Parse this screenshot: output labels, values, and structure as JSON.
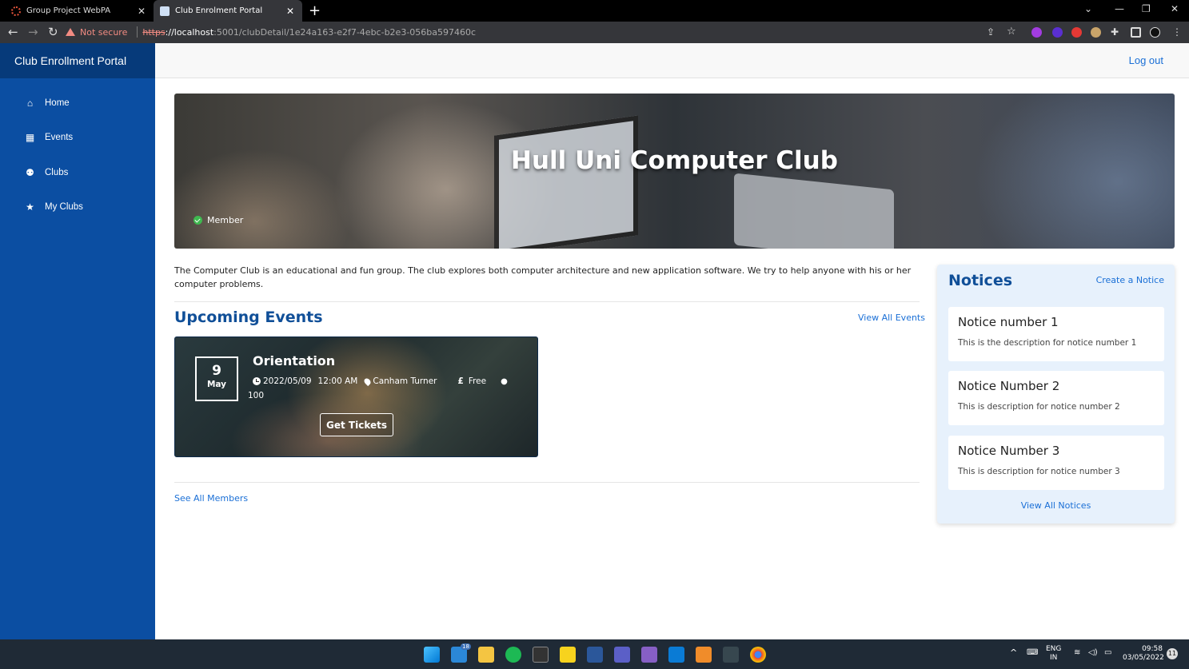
{
  "browser": {
    "tabs": [
      {
        "title": "Group Project WebPA",
        "active": false
      },
      {
        "title": "Club Enrolment Portal",
        "active": true
      }
    ],
    "security_label": "Not secure",
    "url_scheme": "https",
    "url_host": "://localhost",
    "url_path": ":5001/clubDetail/1e24a163-e2f7-4ebc-b2e3-056ba597460c"
  },
  "sidebar": {
    "brand": "Club Enrollment Portal",
    "items": [
      {
        "label": "Home",
        "icon": "home-icon"
      },
      {
        "label": "Events",
        "icon": "calendar-icon"
      },
      {
        "label": "Clubs",
        "icon": "users-icon"
      },
      {
        "label": "My Clubs",
        "icon": "star-icon"
      }
    ]
  },
  "topbar": {
    "logout": "Log out"
  },
  "club": {
    "name": "Hull Uni Computer Club",
    "status": "Member",
    "description": "The Computer Club is an educational and fun group. The club explores both computer architecture and new application software. We try to help anyone with his or her computer problems."
  },
  "events": {
    "title": "Upcoming Events",
    "view_all": "View All Events",
    "items": [
      {
        "day": "9",
        "month": "May",
        "name": "Orientation",
        "date": "2022/05/09",
        "time": "12:00 AM",
        "location": "Canham Turner",
        "currency": "£",
        "price": "Free",
        "capacity": "100",
        "cta": "Get Tickets"
      }
    ]
  },
  "members_link": "See All Members",
  "notices": {
    "title": "Notices",
    "create": "Create a Notice",
    "items": [
      {
        "title": "Notice number 1",
        "description": "This is the description for notice number 1"
      },
      {
        "title": "Notice Number 2",
        "description": "This is description for notice number 2"
      },
      {
        "title": "Notice Number 3",
        "description": "This is description for notice number 3"
      }
    ],
    "view_all": "View All Notices"
  },
  "taskbar": {
    "mail_badge": "18",
    "lang_top": "ENG",
    "lang_bottom": "IN",
    "time": "09:58",
    "date": "03/05/2022",
    "notif_count": "11"
  },
  "colors": {
    "sidebar": "#0b4ea2",
    "brand_bg": "#063a7a",
    "link": "#1a6fd6",
    "heading": "#104f98",
    "notices_bg": "#e7f1fc"
  }
}
